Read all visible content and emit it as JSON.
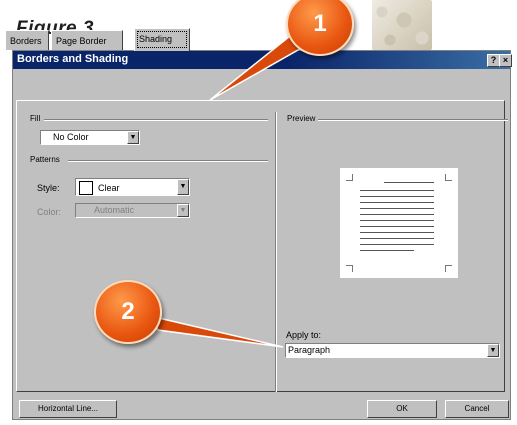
{
  "figure": {
    "title": "Figure 3"
  },
  "dialog": {
    "title": "Borders and Shading",
    "help_glyph": "?",
    "close_glyph": "×",
    "tabs": [
      {
        "label": "Borders",
        "active": false
      },
      {
        "label": "Page Border",
        "active": false
      },
      {
        "label": "Shading",
        "active": true
      }
    ],
    "fill": {
      "label": "Fill",
      "value": "No Color"
    },
    "patterns": {
      "label": "Patterns",
      "style_label": "Style:",
      "style_value": "Clear",
      "color_label": "Color:",
      "color_value": "Automatic",
      "color_disabled": true
    },
    "preview": {
      "label": "Preview"
    },
    "apply_to": {
      "label": "Apply to:",
      "value": "Paragraph"
    },
    "buttons": {
      "horizontal_line": "Horizontal Line...",
      "ok": "OK",
      "cancel": "Cancel"
    }
  },
  "callouts": [
    {
      "number": "1"
    },
    {
      "number": "2"
    }
  ],
  "colors": {
    "titlebar": "#0a246a",
    "callout": "#e85510",
    "dialog_bg": "#c0c0c0"
  }
}
